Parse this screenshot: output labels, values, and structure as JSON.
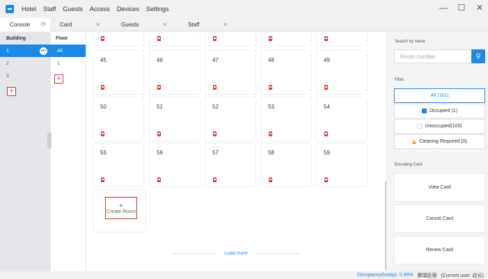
{
  "titlebar": {
    "menu": [
      "Hotel",
      "Staff",
      "Guests",
      "Access",
      "Devices",
      "Settings"
    ],
    "window_controls": {
      "minimize": "—",
      "maximize": "☐",
      "close": "✕"
    }
  },
  "tabs": [
    {
      "label": "Console",
      "icon": "refresh-icon",
      "glyph": "⟳"
    },
    {
      "label": "Card",
      "close": "✕"
    },
    {
      "label": "Guests",
      "close": "✕"
    },
    {
      "label": "Staff",
      "close": "✕"
    }
  ],
  "building": {
    "header": "Building",
    "items": [
      "1",
      "2",
      "3"
    ],
    "add": "+"
  },
  "floor": {
    "header": "Floor",
    "items": [
      "All",
      "1"
    ],
    "add": "+"
  },
  "rooms": {
    "row2": [
      "45",
      "46",
      "47",
      "48",
      "49"
    ],
    "row3": [
      "50",
      "51",
      "52",
      "53",
      "54"
    ],
    "row4": [
      "55",
      "56",
      "57",
      "58",
      "59"
    ]
  },
  "create_room": {
    "plus": "+",
    "label": "Create Room"
  },
  "load_more": "Load more",
  "search": {
    "label": "Search by name",
    "placeholder": "Room number",
    "icon": "search-icon"
  },
  "filter": {
    "label": "Filter",
    "all": "All (101)",
    "occupied": "Occupied (1)",
    "unoccupied": "Unoccupied(100)",
    "cleaning": "Cleaning Required (0)"
  },
  "encoding": {
    "label": "Encoding Card",
    "view": "View Card",
    "cancel": "Cancel Card",
    "renew": "Renew Card"
  },
  "status": {
    "occupancy_label": "Occupancy(today):",
    "occupancy_value": "0.99%",
    "hotel": "赛瑞民宿",
    "user": "(Current user: 店长)"
  },
  "colors": {
    "accent": "#1e88e5",
    "alert": "#d32f2f",
    "warning": "#f5a623"
  }
}
